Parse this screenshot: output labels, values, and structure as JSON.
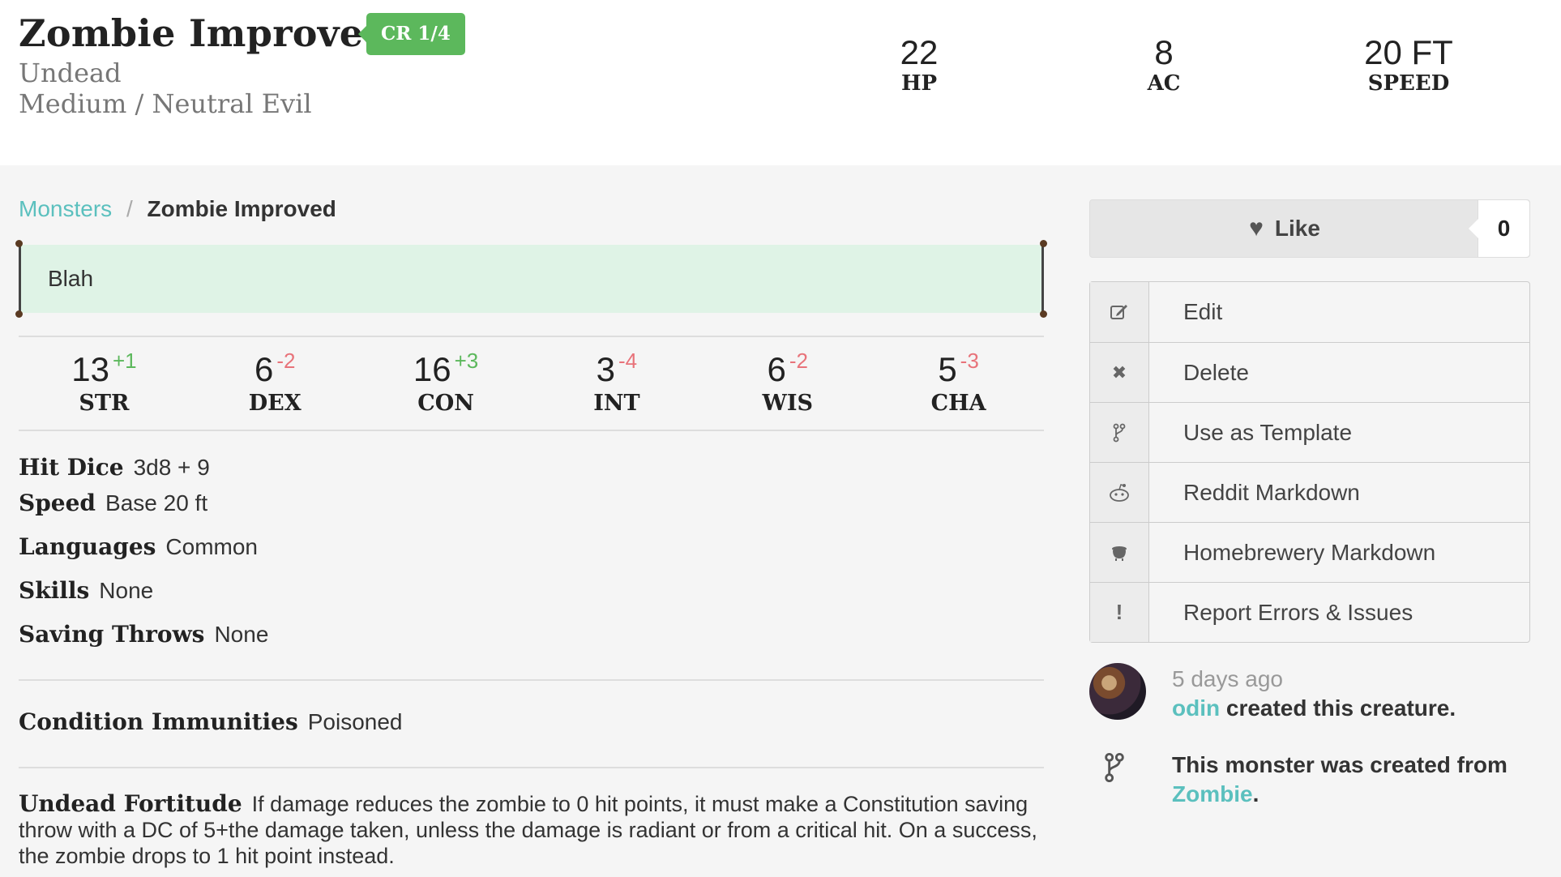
{
  "header": {
    "title": "Zombie Improved",
    "cr": "CR 1/4",
    "type": "Undead",
    "size_alignment": "Medium / Neutral Evil",
    "stats": [
      {
        "value": "22",
        "label": "HP"
      },
      {
        "value": "8",
        "label": "AC"
      },
      {
        "value": "20 FT",
        "label": "SPEED"
      }
    ]
  },
  "breadcrumb": {
    "parent": "Monsters",
    "separator": "/",
    "current": "Zombie Improved"
  },
  "description": "Blah",
  "abilities": [
    {
      "score": "13",
      "mod": "+1",
      "label": "STR"
    },
    {
      "score": "6",
      "mod": "-2",
      "label": "DEX"
    },
    {
      "score": "16",
      "mod": "+3",
      "label": "CON"
    },
    {
      "score": "3",
      "mod": "-4",
      "label": "INT"
    },
    {
      "score": "6",
      "mod": "-2",
      "label": "WIS"
    },
    {
      "score": "5",
      "mod": "-3",
      "label": "CHA"
    }
  ],
  "properties": {
    "hit_dice": {
      "name": "Hit Dice",
      "value": "3d8 + 9"
    },
    "speed": {
      "name": "Speed",
      "value": "Base 20 ft"
    },
    "languages": {
      "name": "Languages",
      "value": "Common"
    },
    "skills": {
      "name": "Skills",
      "value": "None"
    },
    "saving_throws": {
      "name": "Saving Throws",
      "value": "None"
    },
    "condition_immunities": {
      "name": "Condition Immunities",
      "value": "Poisoned"
    }
  },
  "trait": {
    "name": "Undead Fortitude",
    "text": "If damage reduces the zombie to 0 hit points, it must make a Constitution saving throw with a DC of 5+the damage taken, unless the damage is radiant or from a critical hit. On a success, the zombie drops to 1 hit point instead."
  },
  "sidebar": {
    "like_label": "Like",
    "like_count": "0",
    "menu": [
      {
        "icon": "edit-icon",
        "label": "Edit"
      },
      {
        "icon": "close-icon",
        "label": "Delete"
      },
      {
        "icon": "fork-icon",
        "label": "Use as Template"
      },
      {
        "icon": "reddit-icon",
        "label": "Reddit Markdown"
      },
      {
        "icon": "cauldron-icon",
        "label": "Homebrewery Markdown"
      },
      {
        "icon": "exclamation-icon",
        "label": "Report Errors & Issues"
      }
    ],
    "activity": {
      "time": "5 days ago",
      "user": "odin",
      "action": " created this creature.",
      "template_prefix": "This monster was created from ",
      "template_source": "Zombie",
      "template_suffix": "."
    }
  },
  "colors": {
    "accent": "#5bc0be",
    "badge": "#5cb85c",
    "positive": "#5cb85c",
    "negative": "#e8737a",
    "desc_bg": "#dff3e6"
  }
}
